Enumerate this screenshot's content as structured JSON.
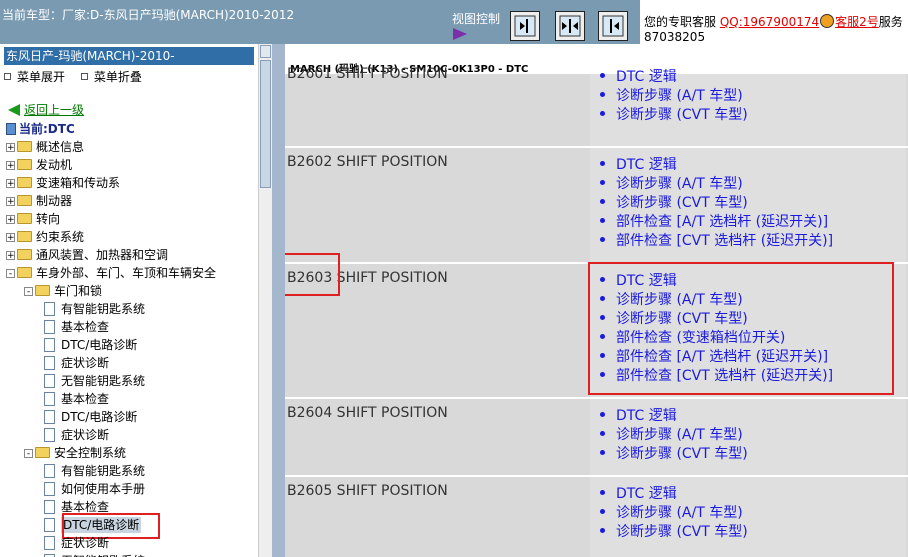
{
  "top": {
    "title": "当前车型：厂家:D-东风日产玛驰(MARCH)2010-2012",
    "view_control": "视图控制",
    "buttons": [
      "collapse-left-icon",
      "split-view-icon",
      "collapse-right-icon"
    ]
  },
  "support": {
    "text": "您的专职客服",
    "qq": "QQ:1967900174",
    "kf2": "客服2号",
    "service": "服务",
    "phone": "87038205"
  },
  "tree": {
    "header": "东风日产-玛驰(MARCH)-2010-",
    "expand": "菜单展开",
    "collapse": "菜单折叠",
    "back": "返回上一级",
    "current": "当前:DTC",
    "nodes": [
      {
        "label": "概述信息",
        "type": "folder",
        "state": "+"
      },
      {
        "label": "发动机",
        "type": "folder",
        "state": "+"
      },
      {
        "label": "变速箱和传动系",
        "type": "folder",
        "state": "+"
      },
      {
        "label": "制动器",
        "type": "folder",
        "state": "+"
      },
      {
        "label": "转向",
        "type": "folder",
        "state": "+"
      },
      {
        "label": "约束系统",
        "type": "folder",
        "state": "+"
      },
      {
        "label": "通风装置、加热器和空调",
        "type": "folder",
        "state": "+"
      },
      {
        "label": "车身外部、车门、车顶和车辆安全",
        "type": "folder",
        "state": "-"
      },
      {
        "label": "车门和锁",
        "type": "folder",
        "state": "-"
      },
      {
        "label": "有智能钥匙系统",
        "type": "doc"
      },
      {
        "label": "基本检查",
        "type": "doc"
      },
      {
        "label": "DTC/电路诊断",
        "type": "doc"
      },
      {
        "label": "症状诊断",
        "type": "doc"
      },
      {
        "label": "无智能钥匙系统",
        "type": "doc"
      },
      {
        "label": "基本检查",
        "type": "doc"
      },
      {
        "label": "DTC/电路诊断",
        "type": "doc"
      },
      {
        "label": "症状诊断",
        "type": "doc"
      },
      {
        "label": "安全控制系统",
        "type": "folder",
        "state": "-"
      },
      {
        "label": "有智能钥匙系统",
        "type": "doc"
      },
      {
        "label": "如何使用本手册",
        "type": "doc"
      },
      {
        "label": "基本检查",
        "type": "doc"
      },
      {
        "label": "DTC/电路诊断",
        "type": "doc",
        "selected": true
      },
      {
        "label": "症状诊断",
        "type": "doc"
      },
      {
        "label": "无智能钥匙系统",
        "type": "doc"
      }
    ]
  },
  "content": {
    "breadcrumb": "MARCH (玛驰) (K13) - SM10C-0K13P0 - DTC",
    "rows": [
      {
        "code": "B2601 SHIFT POSITION",
        "links": [
          "DTC 逻辑",
          "诊断步骤 (A/T 车型)",
          "诊断步骤 (CVT 车型)"
        ]
      },
      {
        "code": "B2602 SHIFT POSITION",
        "links": [
          "DTC 逻辑",
          "诊断步骤 (A/T 车型)",
          "诊断步骤 (CVT 车型)",
          "部件检查 [A/T 选档杆 (延迟开关)]",
          "部件检查 [CVT 选档杆 (延迟开关)]"
        ]
      },
      {
        "code": "B2603 SHIFT POSITION",
        "links": [
          "DTC 逻辑",
          "诊断步骤 (A/T 车型)",
          "诊断步骤 (CVT 车型)",
          "部件检查 (变速箱档位开关)",
          "部件检查 [A/T 选档杆 (延迟开关)]",
          "部件检查 [CVT 选档杆 (延迟开关)]"
        ]
      },
      {
        "code": "B2604 SHIFT POSITION",
        "links": [
          "DTC 逻辑",
          "诊断步骤 (A/T 车型)",
          "诊断步骤 (CVT 车型)"
        ]
      },
      {
        "code": "B2605 SHIFT POSITION",
        "links": [
          "DTC 逻辑",
          "诊断步骤 (A/T 车型)",
          "诊断步骤 (CVT 车型)"
        ]
      }
    ]
  }
}
